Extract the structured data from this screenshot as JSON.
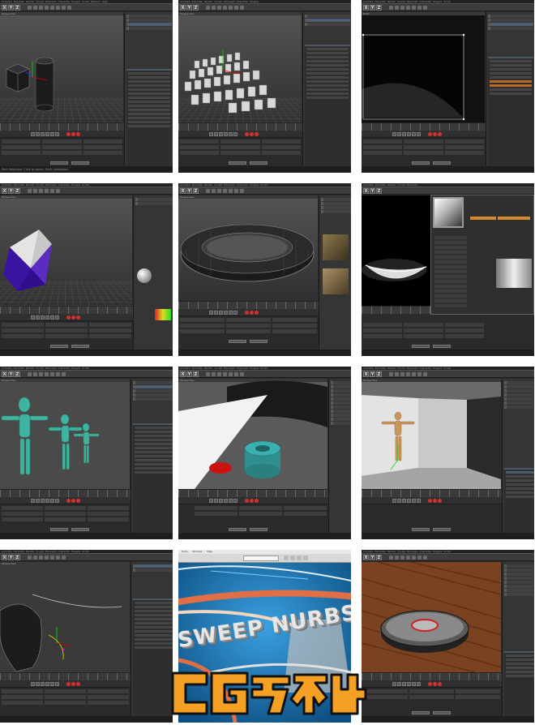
{
  "tiles": [
    {
      "title": "09-04.c4d * - Main",
      "layout": "Layout: Standard",
      "viewport_label": "Perspective",
      "status": "Rect Selection: Click to select,    Shift: Add/select"
    },
    {
      "title": "09-05.c4d * - Main",
      "layout": "Layout: Standard",
      "viewport_label": "Perspective",
      "status": ""
    },
    {
      "title": "09-06.c4d * - Main",
      "layout": "Layout: Standard",
      "viewport_label": "Front",
      "status": ""
    },
    {
      "title": "08-01.c4d * - Main",
      "layout": "",
      "viewport_label": "Perspective",
      "status": ""
    },
    {
      "title": "08-06.c4d * - Main",
      "layout": "",
      "viewport_label": "Perspective",
      "status": ""
    },
    {
      "title": "08-09.c4d * - Main",
      "layout": "",
      "viewport_label": "Perspective",
      "status": ""
    },
    {
      "title": "10-03.c4d * - Main",
      "layout": "",
      "viewport_label": "Perspective",
      "status": ""
    },
    {
      "title": "11-01.c4d * - Main",
      "layout": "",
      "viewport_label": "Perspective",
      "status": ""
    },
    {
      "title": "12-01.c4d * - Main",
      "layout": "",
      "viewport_label": "Perspective",
      "status": ""
    },
    {
      "title": "13-01.c4d * - Main",
      "layout": "",
      "viewport_label": "Perspective",
      "status": ""
    },
    {
      "title": "",
      "layout": "",
      "viewport_label": "",
      "status": ""
    },
    {
      "title": "13-02.c4d * - Main",
      "layout": "",
      "viewport_label": "Perspective",
      "status": ""
    }
  ],
  "menu": [
    "Animate",
    "Simulate",
    "Render",
    "Sculpt",
    "MoGraph",
    "Character",
    "Plugins",
    "Script",
    "Window",
    "Help"
  ],
  "sweep_text": "SWEEP NURBS",
  "preview_menu": {
    "tools": "Tools",
    "window": "Window",
    "help": "Help"
  },
  "watermark": "CG艺术社",
  "colors": {
    "viewport_bg": "#3f3f3f",
    "sweep_bg": "#1e7fbf",
    "sweep_text": "#e6e6e6",
    "watermark_orange": "#f3a024"
  }
}
